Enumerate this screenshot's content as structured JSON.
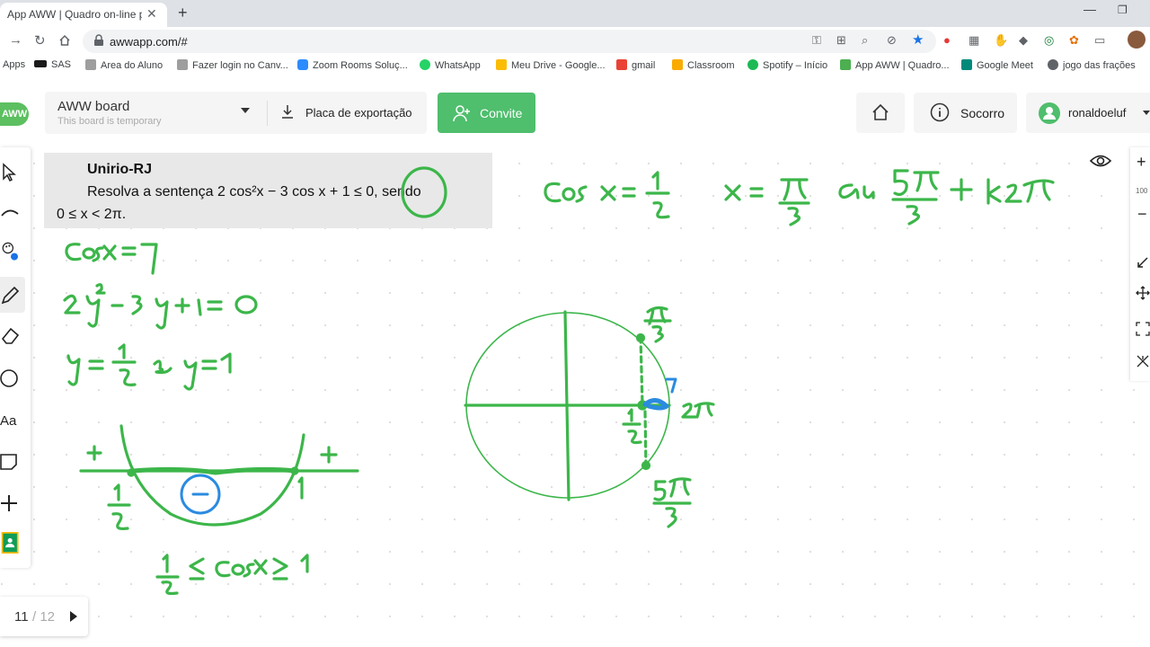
{
  "browser": {
    "tab_title": "App AWW | Quadro on-line para",
    "tab_close": "✕",
    "new_tab": "+",
    "url": "awwapp.com/#",
    "window_min": "—",
    "window_max": "❐"
  },
  "bookmarks": [
    {
      "label": "Apps",
      "color": "#4285f4"
    },
    {
      "label": "SAS",
      "color": "#1a1a1a"
    },
    {
      "label": "Area do Aluno",
      "color": "#9e9e9e"
    },
    {
      "label": "Fazer login no Canv...",
      "color": "#9e9e9e"
    },
    {
      "label": "Zoom Rooms Soluç...",
      "color": "#2d8cff"
    },
    {
      "label": "WhatsApp",
      "color": "#25d366"
    },
    {
      "label": "Meu Drive - Google...",
      "color": "#fbbc05"
    },
    {
      "label": "gmail",
      "color": "#ea4335"
    },
    {
      "label": "Classroom",
      "color": "#f9ab00"
    },
    {
      "label": "Spotify – Início",
      "color": "#1db954"
    },
    {
      "label": "App AWW | Quadro...",
      "color": "#4caf50"
    },
    {
      "label": "Google Meet",
      "color": "#00897b"
    },
    {
      "label": "jogo das frações",
      "color": "#5f6368"
    }
  ],
  "board": {
    "logo": "AWW",
    "name": "AWW board",
    "subtitle": "This board is temporary",
    "export_label": "Placa de exportação",
    "invite_label": "Convite",
    "help_label": "Socorro",
    "user_name": "ronaldoeluf"
  },
  "tools": {
    "text_tool": "Aa"
  },
  "rightbar": {
    "zoom_in": "+",
    "zoom_level": "100",
    "zoom_out": "−"
  },
  "pager": {
    "current": "11",
    "total": "/ 12"
  },
  "problem": {
    "source": "Unirio-RJ",
    "line1": "Resolva a sentença 2 cos²x − 3 cos x + 1 ≤ 0, sendo",
    "line2": "0 ≤ x < 2π."
  },
  "colors": {
    "ink_green": "#3cb64a",
    "ink_blue": "#2b8be0",
    "invite": "#4fbe6d"
  }
}
